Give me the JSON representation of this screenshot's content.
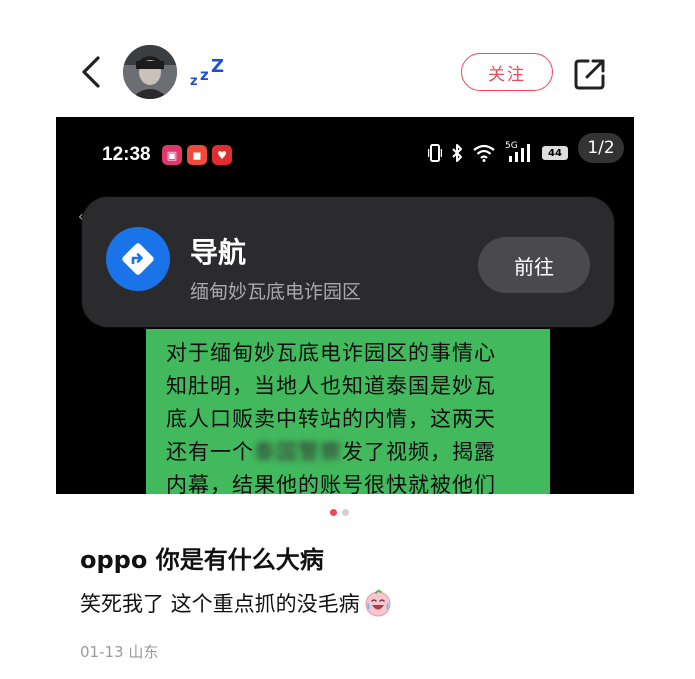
{
  "header": {
    "zzz_text": [
      "z",
      "z",
      "Z"
    ],
    "follow_label": "关注"
  },
  "screenshot": {
    "status_time": "12:38",
    "network_label": "5G",
    "battery_level": "44",
    "page_counter": "1/2",
    "notification": {
      "title": "导航",
      "subtitle": "缅甸妙瓦底电诈园区",
      "button_label": "前往"
    },
    "chat_bubble_lines": [
      "对于缅甸妙瓦底电诈园区的事情心",
      "知肚明，当地人也知道泰国是妙瓦",
      "底人口贩卖中转站的内情，这两天",
      "还有一个",
      "发了视频，揭露",
      "内幕，结果他的账号很快就被他们"
    ],
    "blurred_text": "泰国警察"
  },
  "carousel": {
    "total": 2,
    "active": 0
  },
  "post": {
    "title": "oppo 你是有什么大病",
    "body": "笑死我了  这个重点抓的没毛病",
    "meta": "01-13 山东"
  },
  "colors": {
    "accent": "#f0485a",
    "bubble_green": "#42b95d",
    "nav_blue": "#1a73e8"
  }
}
